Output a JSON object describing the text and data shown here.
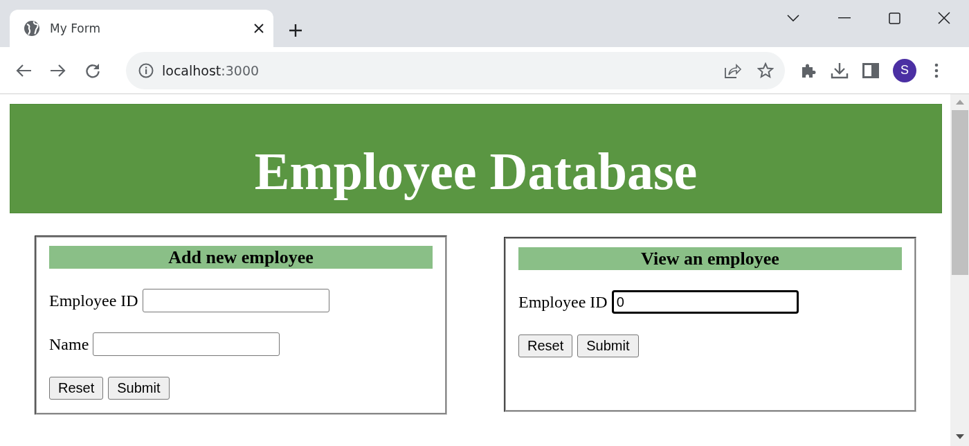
{
  "browser": {
    "tab_title": "My Form",
    "url_host": "localhost",
    "url_port": ":3000",
    "profile_initial": "S"
  },
  "header": {
    "title": "Employee Database"
  },
  "forms": [
    {
      "title": "Add new employee",
      "fields": [
        {
          "label": "Employee ID",
          "focused": false
        },
        {
          "label": "Name",
          "focused": false
        }
      ],
      "buttons": [
        "Reset",
        "Submit"
      ]
    },
    {
      "title": "View an employee",
      "fields": [
        {
          "label": "Employee ID",
          "value": "0",
          "focused": true
        }
      ],
      "buttons": [
        "Reset",
        "Submit"
      ]
    }
  ]
}
